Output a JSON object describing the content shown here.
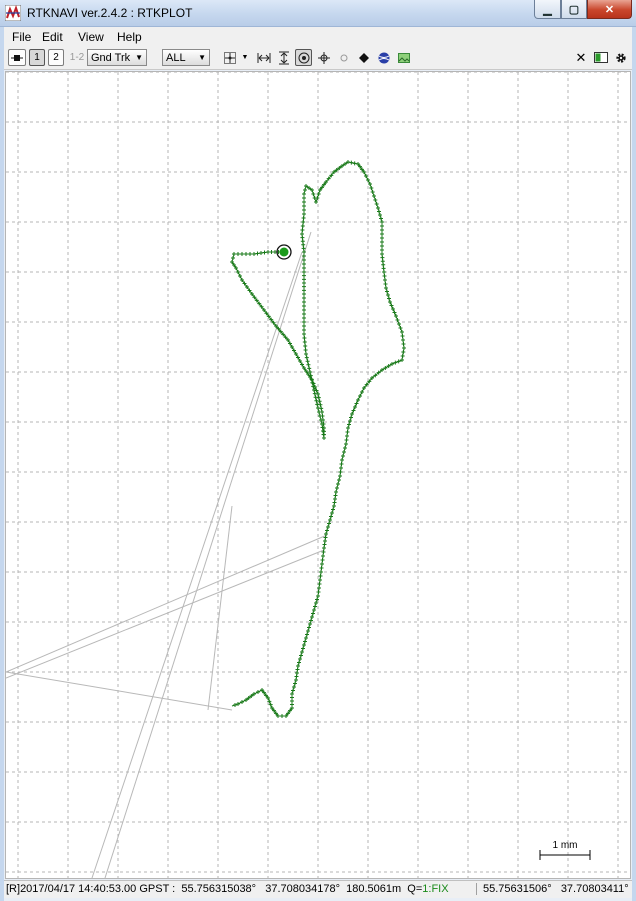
{
  "window": {
    "title": "RTKNAVI ver.2.4.2 : RTKPLOT",
    "minimize_glyph": "▁",
    "maximize_glyph": "▢",
    "close_glyph": "✕"
  },
  "menu": [
    "File",
    "Edit",
    "View",
    "Help"
  ],
  "toolbar": {
    "btn1": "1",
    "btn2": "2",
    "btn12": "1-2",
    "plot_type": "Gnd Trk",
    "sat_filter": "ALL",
    "dropdown_arrow": "▼",
    "close_glyph": "✕"
  },
  "plot": {
    "scale_label": "1 mm",
    "track_color": "#1a7a1a",
    "grid_color": "#b4b4b4"
  },
  "status": {
    "prefix": "[R]",
    "datetime": "2017/04/17 14:40:53.00 GPST :",
    "lat": "55.756315038°",
    "lon": "37.708034178°",
    "height": "180.5061m",
    "q_label": "Q=",
    "q_value": "1:FIX",
    "cursor_lat": "55.75631506°",
    "cursor_lon": "37.70803411°"
  }
}
